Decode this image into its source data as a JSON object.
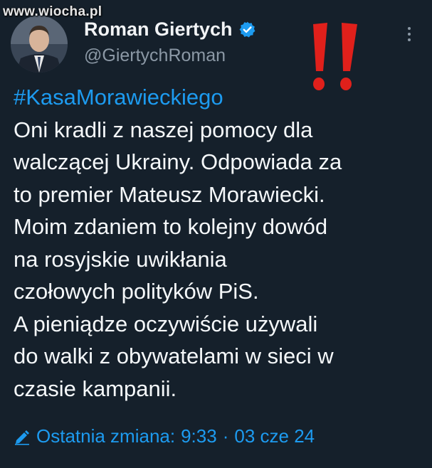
{
  "watermark": "www.wiocha.pl",
  "author": {
    "display_name": "Roman Giertych",
    "handle": "@GiertychRoman"
  },
  "tweet": {
    "hashtag": "#KasaMorawieckiego",
    "lines": [
      "Oni kradli z naszej pomocy dla",
      "walczącej Ukrainy. Odpowiada za",
      "to premier Mateusz Morawiecki.",
      "Moim zdaniem to kolejny dowód",
      "na rosyjskie uwikłania",
      "czołowych polityków PiS.",
      "A pieniądze oczywiście używali",
      "do walki z obywatelami w sieci w",
      "czasie kampanii."
    ]
  },
  "meta": {
    "edited_label": "Ostatnia zmiana:",
    "time": "9:33",
    "separator": "·",
    "date": "03 cze 24"
  },
  "icons": {
    "verified": "verified-badge-icon",
    "more": "more-options-icon",
    "annotation": "double-exclamation-icon",
    "edit": "pencil-icon"
  },
  "colors": {
    "background": "#15202b",
    "accent": "#1d9bf0",
    "secondary_text": "#8b98a5",
    "annotation": "#e0201b"
  }
}
